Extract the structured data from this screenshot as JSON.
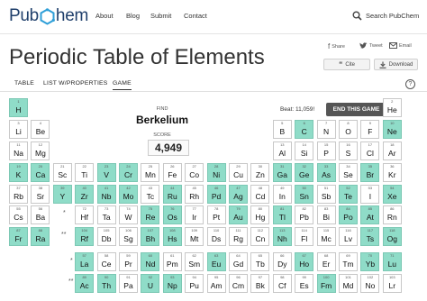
{
  "header": {
    "logo_left": "Pub",
    "logo_right": "hem",
    "nav": [
      "About",
      "Blog",
      "Submit",
      "Contact"
    ],
    "search_label": "Search PubChem"
  },
  "page": {
    "title": "Periodic Table of Elements",
    "share_label": "Share",
    "tweet_label": "Tweet",
    "email_label": "Email",
    "cite_label": "Cite",
    "download_label": "Download"
  },
  "tabs": [
    {
      "label": "TABLE",
      "active": false
    },
    {
      "label": "LIST W/PROPERTIES",
      "active": false
    },
    {
      "label": "GAME",
      "active": true
    }
  ],
  "game": {
    "find_label": "FIND",
    "target_element": "Berkelium",
    "score_label": "SCORE",
    "score": "4,949",
    "beat_text": "Beat: 11,059!",
    "end_button": "END THIS GAME"
  },
  "colors": {
    "found": "#8fdcc8",
    "empty": "#ffffff",
    "brand": "#1f3f6b"
  },
  "elements": [
    {
      "n": 1,
      "s": "H",
      "r": 1,
      "c": 1,
      "found": true
    },
    {
      "n": 2,
      "s": "He",
      "r": 1,
      "c": 18,
      "found": false
    },
    {
      "n": 3,
      "s": "Li",
      "r": 2,
      "c": 1,
      "found": false
    },
    {
      "n": 4,
      "s": "Be",
      "r": 2,
      "c": 2,
      "found": false
    },
    {
      "n": 5,
      "s": "B",
      "r": 2,
      "c": 13,
      "found": false
    },
    {
      "n": 6,
      "s": "C",
      "r": 2,
      "c": 14,
      "found": true
    },
    {
      "n": 7,
      "s": "N",
      "r": 2,
      "c": 15,
      "found": false
    },
    {
      "n": 8,
      "s": "O",
      "r": 2,
      "c": 16,
      "found": false
    },
    {
      "n": 9,
      "s": "F",
      "r": 2,
      "c": 17,
      "found": false
    },
    {
      "n": 10,
      "s": "Ne",
      "r": 2,
      "c": 18,
      "found": true
    },
    {
      "n": 11,
      "s": "Na",
      "r": 3,
      "c": 1,
      "found": false
    },
    {
      "n": 12,
      "s": "Mg",
      "r": 3,
      "c": 2,
      "found": false
    },
    {
      "n": 13,
      "s": "Al",
      "r": 3,
      "c": 13,
      "found": false
    },
    {
      "n": 14,
      "s": "Si",
      "r": 3,
      "c": 14,
      "found": false
    },
    {
      "n": 15,
      "s": "P",
      "r": 3,
      "c": 15,
      "found": false
    },
    {
      "n": 16,
      "s": "S",
      "r": 3,
      "c": 16,
      "found": false
    },
    {
      "n": 17,
      "s": "Cl",
      "r": 3,
      "c": 17,
      "found": false
    },
    {
      "n": 18,
      "s": "Ar",
      "r": 3,
      "c": 18,
      "found": false
    },
    {
      "n": 19,
      "s": "K",
      "r": 4,
      "c": 1,
      "found": true
    },
    {
      "n": 20,
      "s": "Ca",
      "r": 4,
      "c": 2,
      "found": true
    },
    {
      "n": 21,
      "s": "Sc",
      "r": 4,
      "c": 3,
      "found": false
    },
    {
      "n": 22,
      "s": "Ti",
      "r": 4,
      "c": 4,
      "found": false
    },
    {
      "n": 23,
      "s": "V",
      "r": 4,
      "c": 5,
      "found": true
    },
    {
      "n": 24,
      "s": "Cr",
      "r": 4,
      "c": 6,
      "found": true
    },
    {
      "n": 25,
      "s": "Mn",
      "r": 4,
      "c": 7,
      "found": false
    },
    {
      "n": 26,
      "s": "Fe",
      "r": 4,
      "c": 8,
      "found": false
    },
    {
      "n": 27,
      "s": "Co",
      "r": 4,
      "c": 9,
      "found": false
    },
    {
      "n": 28,
      "s": "Ni",
      "r": 4,
      "c": 10,
      "found": true
    },
    {
      "n": 29,
      "s": "Cu",
      "r": 4,
      "c": 11,
      "found": false
    },
    {
      "n": 30,
      "s": "Zn",
      "r": 4,
      "c": 12,
      "found": false
    },
    {
      "n": 31,
      "s": "Ga",
      "r": 4,
      "c": 13,
      "found": true
    },
    {
      "n": 32,
      "s": "Ge",
      "r": 4,
      "c": 14,
      "found": true
    },
    {
      "n": 33,
      "s": "As",
      "r": 4,
      "c": 15,
      "found": true
    },
    {
      "n": 34,
      "s": "Se",
      "r": 4,
      "c": 16,
      "found": false
    },
    {
      "n": 35,
      "s": "Br",
      "r": 4,
      "c": 17,
      "found": true
    },
    {
      "n": 36,
      "s": "Kr",
      "r": 4,
      "c": 18,
      "found": false
    },
    {
      "n": 37,
      "s": "Rb",
      "r": 5,
      "c": 1,
      "found": false
    },
    {
      "n": 38,
      "s": "Sr",
      "r": 5,
      "c": 2,
      "found": false
    },
    {
      "n": 39,
      "s": "Y",
      "r": 5,
      "c": 3,
      "found": true
    },
    {
      "n": 40,
      "s": "Zr",
      "r": 5,
      "c": 4,
      "found": true
    },
    {
      "n": 41,
      "s": "Nb",
      "r": 5,
      "c": 5,
      "found": true
    },
    {
      "n": 42,
      "s": "Mo",
      "r": 5,
      "c": 6,
      "found": true
    },
    {
      "n": 43,
      "s": "Tc",
      "r": 5,
      "c": 7,
      "found": false
    },
    {
      "n": 44,
      "s": "Ru",
      "r": 5,
      "c": 8,
      "found": true
    },
    {
      "n": 45,
      "s": "Rh",
      "r": 5,
      "c": 9,
      "found": false
    },
    {
      "n": 46,
      "s": "Pd",
      "r": 5,
      "c": 10,
      "found": true
    },
    {
      "n": 47,
      "s": "Ag",
      "r": 5,
      "c": 11,
      "found": true
    },
    {
      "n": 48,
      "s": "Cd",
      "r": 5,
      "c": 12,
      "found": false
    },
    {
      "n": 49,
      "s": "In",
      "r": 5,
      "c": 13,
      "found": false
    },
    {
      "n": 50,
      "s": "Sn",
      "r": 5,
      "c": 14,
      "found": true
    },
    {
      "n": 51,
      "s": "Sb",
      "r": 5,
      "c": 15,
      "found": false
    },
    {
      "n": 52,
      "s": "Te",
      "r": 5,
      "c": 16,
      "found": true
    },
    {
      "n": 53,
      "s": "I",
      "r": 5,
      "c": 17,
      "found": false
    },
    {
      "n": 54,
      "s": "Xe",
      "r": 5,
      "c": 18,
      "found": true
    },
    {
      "n": 55,
      "s": "Cs",
      "r": 6,
      "c": 1,
      "found": false
    },
    {
      "n": 56,
      "s": "Ba",
      "r": 6,
      "c": 2,
      "found": false
    },
    {
      "n": 72,
      "s": "Hf",
      "r": 6,
      "c": 4,
      "found": false
    },
    {
      "n": 73,
      "s": "Ta",
      "r": 6,
      "c": 5,
      "found": false
    },
    {
      "n": 74,
      "s": "W",
      "r": 6,
      "c": 6,
      "found": false
    },
    {
      "n": 75,
      "s": "Re",
      "r": 6,
      "c": 7,
      "found": true
    },
    {
      "n": 76,
      "s": "Os",
      "r": 6,
      "c": 8,
      "found": true
    },
    {
      "n": 77,
      "s": "Ir",
      "r": 6,
      "c": 9,
      "found": false
    },
    {
      "n": 78,
      "s": "Pt",
      "r": 6,
      "c": 10,
      "found": false
    },
    {
      "n": 79,
      "s": "Au",
      "r": 6,
      "c": 11,
      "found": true
    },
    {
      "n": 80,
      "s": "Hg",
      "r": 6,
      "c": 12,
      "found": false
    },
    {
      "n": 81,
      "s": "Tl",
      "r": 6,
      "c": 13,
      "found": true
    },
    {
      "n": 82,
      "s": "Pb",
      "r": 6,
      "c": 14,
      "found": false
    },
    {
      "n": 83,
      "s": "Bi",
      "r": 6,
      "c": 15,
      "found": false
    },
    {
      "n": 84,
      "s": "Po",
      "r": 6,
      "c": 16,
      "found": true
    },
    {
      "n": 85,
      "s": "At",
      "r": 6,
      "c": 17,
      "found": true
    },
    {
      "n": 86,
      "s": "Rn",
      "r": 6,
      "c": 18,
      "found": false
    },
    {
      "n": 87,
      "s": "Fr",
      "r": 7,
      "c": 1,
      "found": true
    },
    {
      "n": 88,
      "s": "Ra",
      "r": 7,
      "c": 2,
      "found": true
    },
    {
      "n": 104,
      "s": "Rf",
      "r": 7,
      "c": 4,
      "found": true
    },
    {
      "n": 105,
      "s": "Db",
      "r": 7,
      "c": 5,
      "found": false
    },
    {
      "n": 106,
      "s": "Sg",
      "r": 7,
      "c": 6,
      "found": false
    },
    {
      "n": 107,
      "s": "Bh",
      "r": 7,
      "c": 7,
      "found": true
    },
    {
      "n": 108,
      "s": "Hs",
      "r": 7,
      "c": 8,
      "found": true
    },
    {
      "n": 109,
      "s": "Mt",
      "r": 7,
      "c": 9,
      "found": false
    },
    {
      "n": 110,
      "s": "Ds",
      "r": 7,
      "c": 10,
      "found": false
    },
    {
      "n": 111,
      "s": "Rg",
      "r": 7,
      "c": 11,
      "found": false
    },
    {
      "n": 112,
      "s": "Cn",
      "r": 7,
      "c": 12,
      "found": false
    },
    {
      "n": 113,
      "s": "Nh",
      "r": 7,
      "c": 13,
      "found": true
    },
    {
      "n": 114,
      "s": "Fl",
      "r": 7,
      "c": 14,
      "found": false
    },
    {
      "n": 115,
      "s": "Mc",
      "r": 7,
      "c": 15,
      "found": false
    },
    {
      "n": 116,
      "s": "Lv",
      "r": 7,
      "c": 16,
      "found": false
    },
    {
      "n": 117,
      "s": "Ts",
      "r": 7,
      "c": 17,
      "found": true
    },
    {
      "n": 118,
      "s": "Og",
      "r": 7,
      "c": 18,
      "found": true
    },
    {
      "n": 57,
      "s": "La",
      "r": 9,
      "c": 4,
      "found": true
    },
    {
      "n": 58,
      "s": "Ce",
      "r": 9,
      "c": 5,
      "found": false
    },
    {
      "n": 59,
      "s": "Pr",
      "r": 9,
      "c": 6,
      "found": false
    },
    {
      "n": 60,
      "s": "Nd",
      "r": 9,
      "c": 7,
      "found": true
    },
    {
      "n": 61,
      "s": "Pm",
      "r": 9,
      "c": 8,
      "found": false
    },
    {
      "n": 62,
      "s": "Sm",
      "r": 9,
      "c": 9,
      "found": false
    },
    {
      "n": 63,
      "s": "Eu",
      "r": 9,
      "c": 10,
      "found": true
    },
    {
      "n": 64,
      "s": "Gd",
      "r": 9,
      "c": 11,
      "found": false
    },
    {
      "n": 65,
      "s": "Tb",
      "r": 9,
      "c": 12,
      "found": false
    },
    {
      "n": 66,
      "s": "Dy",
      "r": 9,
      "c": 13,
      "found": false
    },
    {
      "n": 67,
      "s": "Ho",
      "r": 9,
      "c": 14,
      "found": true
    },
    {
      "n": 68,
      "s": "Er",
      "r": 9,
      "c": 15,
      "found": false
    },
    {
      "n": 69,
      "s": "Tm",
      "r": 9,
      "c": 16,
      "found": false
    },
    {
      "n": 70,
      "s": "Yb",
      "r": 9,
      "c": 17,
      "found": true
    },
    {
      "n": 71,
      "s": "Lu",
      "r": 9,
      "c": 18,
      "found": true
    },
    {
      "n": 89,
      "s": "Ac",
      "r": 10,
      "c": 4,
      "found": true
    },
    {
      "n": 90,
      "s": "Th",
      "r": 10,
      "c": 5,
      "found": true
    },
    {
      "n": 91,
      "s": "Pa",
      "r": 10,
      "c": 6,
      "found": false
    },
    {
      "n": 92,
      "s": "U",
      "r": 10,
      "c": 7,
      "found": true
    },
    {
      "n": 93,
      "s": "Np",
      "r": 10,
      "c": 8,
      "found": true
    },
    {
      "n": 94,
      "s": "Pu",
      "r": 10,
      "c": 9,
      "found": false
    },
    {
      "n": 95,
      "s": "Am",
      "r": 10,
      "c": 10,
      "found": false
    },
    {
      "n": 96,
      "s": "Cm",
      "r": 10,
      "c": 11,
      "found": false
    },
    {
      "n": 97,
      "s": "Bk",
      "r": 10,
      "c": 12,
      "found": false
    },
    {
      "n": 98,
      "s": "Cf",
      "r": 10,
      "c": 13,
      "found": false
    },
    {
      "n": 99,
      "s": "Es",
      "r": 10,
      "c": 14,
      "found": false
    },
    {
      "n": 100,
      "s": "Fm",
      "r": 10,
      "c": 15,
      "found": true
    },
    {
      "n": 101,
      "s": "Md",
      "r": 10,
      "c": 16,
      "found": false
    },
    {
      "n": 102,
      "s": "No",
      "r": 10,
      "c": 17,
      "found": false
    },
    {
      "n": 103,
      "s": "Lr",
      "r": 10,
      "c": 18,
      "found": false
    }
  ],
  "markers": {
    "lanthanide": "*",
    "actinide": "**"
  }
}
